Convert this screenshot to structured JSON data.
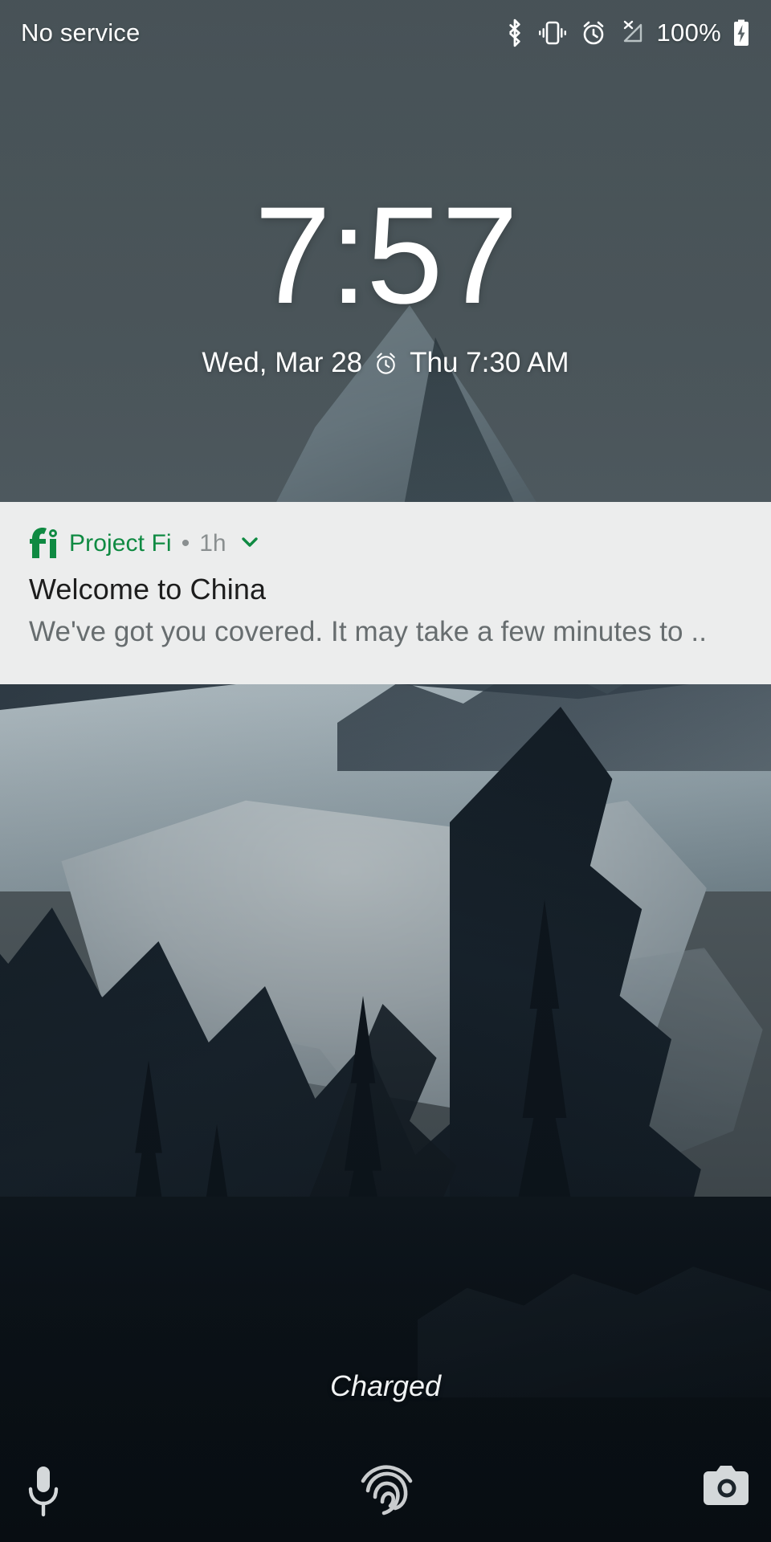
{
  "status_bar": {
    "carrier": "No service",
    "battery_percent": "100%",
    "icons": [
      "bluetooth-icon",
      "vibrate-icon",
      "alarm-icon",
      "no-signal-icon",
      "battery-charging-icon"
    ]
  },
  "clock": {
    "time": "7:57",
    "date": "Wed, Mar 28",
    "alarm_icon": "alarm-icon",
    "next_alarm": "Thu 7:30 AM"
  },
  "notification": {
    "app_name": "Project Fi",
    "separator": "•",
    "time_ago": "1h",
    "title": "Welcome to China",
    "body": "We've got you covered. It may take a few minutes to ..",
    "app_icon": "project-fi-icon",
    "expand_icon": "chevron-down-icon"
  },
  "bottom": {
    "charge_status": "Charged",
    "fingerprint_icon": "fingerprint-icon",
    "left_shortcut_icon": "microphone-icon",
    "right_shortcut_icon": "camera-icon"
  },
  "colors": {
    "notification_background": "#eceded",
    "app_accent": "#0f8a42",
    "primary_text": "#ffffff",
    "notification_title_text": "#1d1d1d",
    "notification_body_text": "#676d6f",
    "status_bar_scrim": "#5a6468"
  }
}
